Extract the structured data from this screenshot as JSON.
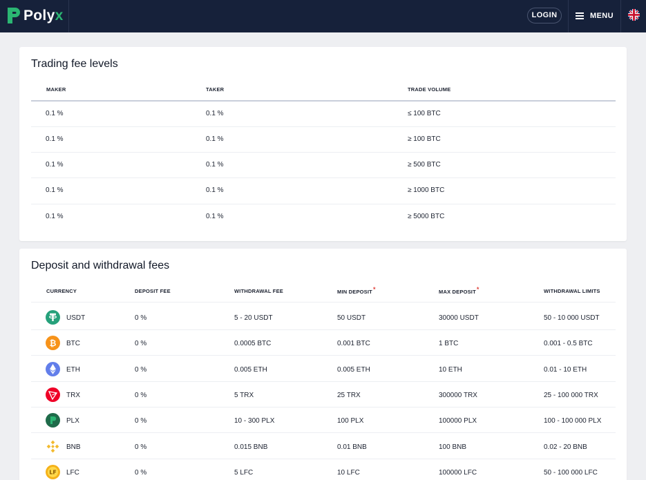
{
  "header": {
    "brand": "Poly",
    "brand_x": "x",
    "login_label": "LOGIN",
    "menu_label": "MENU",
    "language_icon": "uk-flag-icon"
  },
  "trading_fees": {
    "title": "Trading fee levels",
    "columns": [
      "MAKER",
      "TAKER",
      "TRADE VOLUME"
    ],
    "rows": [
      {
        "maker": "0.1 %",
        "taker": "0.1 %",
        "volume": "≤ 100 BTC"
      },
      {
        "maker": "0.1 %",
        "taker": "0.1 %",
        "volume": "≥ 100 BTC"
      },
      {
        "maker": "0.1 %",
        "taker": "0.1 %",
        "volume": "≥ 500 BTC"
      },
      {
        "maker": "0.1 %",
        "taker": "0.1 %",
        "volume": "≥ 1000 BTC"
      },
      {
        "maker": "0.1 %",
        "taker": "0.1 %",
        "volume": "≥ 5000 BTC"
      }
    ]
  },
  "deposit_fees": {
    "title": "Deposit and withdrawal fees",
    "columns": [
      "CURRENCY",
      "DEPOSIT FEE",
      "WITHDRAWAL FEE",
      "MIN DEPOSIT",
      "MAX DEPOSIT",
      "WITHDRAWAL LIMITS"
    ],
    "required_marker": "*",
    "rows": [
      {
        "currency": "USDT",
        "icon": "usdt-icon",
        "color": "#26a17b",
        "deposit_fee": "0 %",
        "withdrawal_fee": "5 - 20 USDT",
        "min_deposit": "50 USDT",
        "max_deposit": "30000 USDT",
        "withdrawal_limits": "50 - 10 000 USDT"
      },
      {
        "currency": "BTC",
        "icon": "btc-icon",
        "color": "#f7931a",
        "deposit_fee": "0 %",
        "withdrawal_fee": "0.0005 BTC",
        "min_deposit": "0.001 BTC",
        "max_deposit": "1 BTC",
        "withdrawal_limits": "0.001 - 0.5 BTC"
      },
      {
        "currency": "ETH",
        "icon": "eth-icon",
        "color": "#627eea",
        "deposit_fee": "0 %",
        "withdrawal_fee": "0.005 ETH",
        "min_deposit": "0.005 ETH",
        "max_deposit": "10 ETH",
        "withdrawal_limits": "0.01 - 10 ETH"
      },
      {
        "currency": "TRX",
        "icon": "trx-icon",
        "color": "#ef0027",
        "deposit_fee": "0 %",
        "withdrawal_fee": "5 TRX",
        "min_deposit": "25 TRX",
        "max_deposit": "300000 TRX",
        "withdrawal_limits": "25 - 100 000 TRX"
      },
      {
        "currency": "PLX",
        "icon": "plx-icon",
        "color": "#1f6b4a",
        "deposit_fee": "0 %",
        "withdrawal_fee": "10 - 300 PLX",
        "min_deposit": "100 PLX",
        "max_deposit": "100000 PLX",
        "withdrawal_limits": "100 - 100 000 PLX"
      },
      {
        "currency": "BNB",
        "icon": "bnb-icon",
        "color": "#f3ba2f",
        "deposit_fee": "0 %",
        "withdrawal_fee": "0.015 BNB",
        "min_deposit": "0.01 BNB",
        "max_deposit": "100 BNB",
        "withdrawal_limits": "0.02 - 20 BNB"
      },
      {
        "currency": "LFC",
        "icon": "lfc-icon",
        "color": "#f5b21a",
        "deposit_fee": "0 %",
        "withdrawal_fee": "5 LFC",
        "min_deposit": "10 LFC",
        "max_deposit": "100000 LFC",
        "withdrawal_limits": "50 - 100 000 LFC"
      }
    ]
  }
}
